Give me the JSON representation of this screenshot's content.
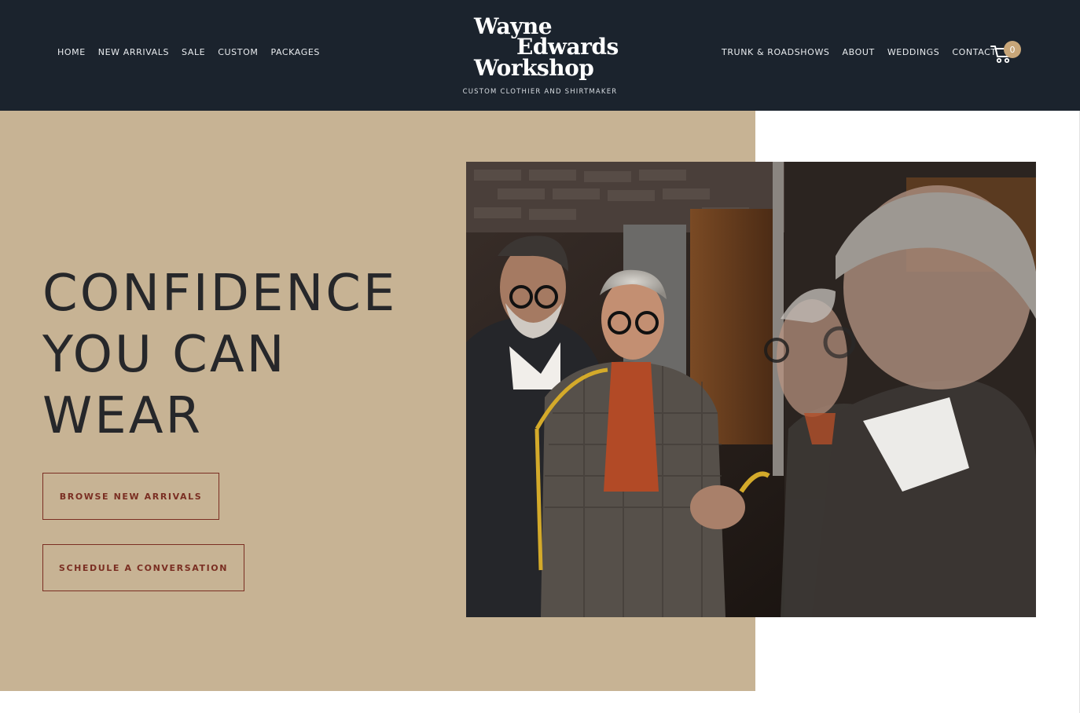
{
  "header": {
    "nav_left": [
      "HOME",
      "NEW ARRIVALS",
      "SALE",
      "CUSTOM",
      "PACKAGES"
    ],
    "nav_right": [
      "TRUNK & ROADSHOWS",
      "ABOUT",
      "WEDDINGS",
      "CONTACT"
    ],
    "logo": {
      "line1": "Wayne",
      "line2": "Edwards",
      "line3": "Workshop",
      "tagline": "CUSTOM CLOTHIER AND SHIRTMAKER"
    },
    "cart": {
      "count": "0",
      "icon": "cart-icon"
    }
  },
  "hero": {
    "headline": [
      "CONFIDENCE",
      "YOU CAN",
      "WEAR"
    ],
    "buttons": {
      "browse": "BROWSE NEW ARRIVALS",
      "schedule": "SCHEDULE A CONVERSATION"
    }
  },
  "colors": {
    "header_bg": "#1b232d",
    "hero_panel": "#c7b394",
    "accent": "#7a2e22",
    "badge": "#c8a679"
  }
}
